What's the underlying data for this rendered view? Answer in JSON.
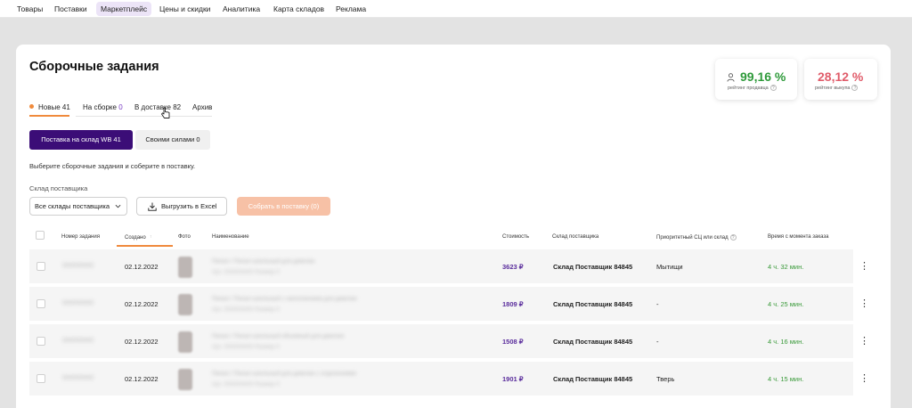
{
  "top_nav": {
    "items": [
      {
        "label": "Товары"
      },
      {
        "label": "Поставки"
      },
      {
        "label": "Маркетплейс",
        "active": true
      },
      {
        "label": "Цены и скидки"
      },
      {
        "label": "Аналитика"
      },
      {
        "label": "Карта складов"
      },
      {
        "label": "Реклама"
      }
    ]
  },
  "page": {
    "title": "Сборочные задания"
  },
  "ratings": {
    "seller": {
      "value": "99,16 %",
      "label": "рейтинг продавца",
      "color": "#2e9a3a",
      "icon": "user-icon"
    },
    "buyout": {
      "value": "28,12 %",
      "label": "рейтинг выкупа",
      "color": "#e05c6a"
    }
  },
  "tabs": [
    {
      "label": "Новые",
      "count": "41",
      "active": true
    },
    {
      "label": "На сборке",
      "count": "0"
    },
    {
      "label": "В доставке",
      "count": "82"
    },
    {
      "label": "Архив",
      "count": ""
    }
  ],
  "segments": {
    "wb": "Поставка на склад WB 41",
    "own": "Своими силами 0"
  },
  "instruction": "Выберите сборочные задания и соберите в поставку.",
  "filters": {
    "warehouse_label": "Склад поставщика",
    "warehouse_select": "Все склады поставщика",
    "export_button": "Выгрузить в Excel",
    "collect_button": "Собрать в поставку (0)"
  },
  "table": {
    "columns": {
      "order_no": "Номер задания",
      "created": "Создано",
      "photo": "Фото",
      "name": "Наименование",
      "price": "Стоимость",
      "warehouse": "Склад поставщика",
      "priority": "Приоритетный СЦ или склад",
      "elapsed": "Время с момента заказа"
    },
    "rows": [
      {
        "order_no": "000000000",
        "created": "02.12.2022",
        "name": "Пенал / Пенал школьный для девочки",
        "name_sub": "Арт. 000000000   Размер 0",
        "price": "3623 ₽",
        "warehouse": "Склад Поставщик 84845",
        "priority": "Мытищи",
        "elapsed": "4 ч. 32 мин."
      },
      {
        "order_no": "000000000",
        "created": "02.12.2022",
        "name": "Пенал / Пенал школьный с наполнением для девочки",
        "name_sub": "Арт. 000000000   Размер 0",
        "price": "1809 ₽",
        "warehouse": "Склад Поставщик 84845",
        "priority": "-",
        "elapsed": "4 ч. 25 мин."
      },
      {
        "order_no": "000000000",
        "created": "02.12.2022",
        "name": "Пенал / Пенал школьный объемный для девочки",
        "name_sub": "Арт. 000000000   Размер 0",
        "price": "1508 ₽",
        "warehouse": "Склад Поставщик 84845",
        "priority": "-",
        "elapsed": "4 ч. 16 мин."
      },
      {
        "order_no": "000000000",
        "created": "02.12.2022",
        "name": "Пенал / Пенал школьный для девочки с отделениями",
        "name_sub": "Арт. 000000000   Размер 0",
        "price": "1901 ₽",
        "warehouse": "Склад Поставщик 84845",
        "priority": "Тверь",
        "elapsed": "4 ч. 15 мин."
      }
    ]
  },
  "colors": {
    "accent_purple": "#3b0d77",
    "accent_orange": "#f08a3c",
    "price_purple": "#5a2d9c",
    "elapsed_green": "#3a9a3a"
  }
}
